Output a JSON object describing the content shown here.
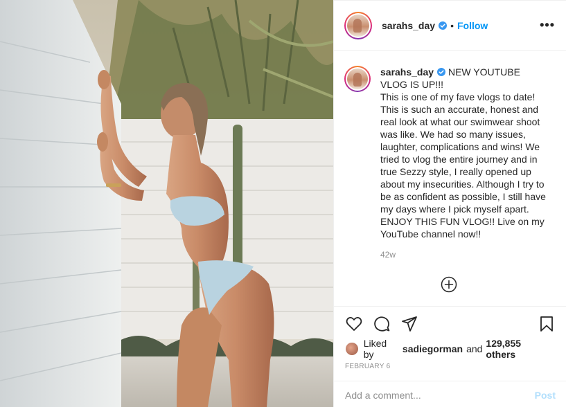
{
  "post": {
    "username": "sarahs_day",
    "verified_icon": "verified-badge-icon",
    "dot": "•",
    "follow_label": "Follow",
    "more_icon": "more-options-icon",
    "more_glyph": "•••",
    "caption_headline": "NEW YOUTUBE VLOG IS UP!!!",
    "caption_body": "This is one of my fave vlogs to date! This is such an accurate, honest and real look at what our swimwear shoot was like. We had so many issues, laughter, complications and wins! We tried to vlog the entire journey and in true Sezzy style, I really opened up about my insecurities. Although I try to be as confident as possible, I still have my days where I pick myself apart. ENJOY THIS FUN VLOG!! Live on my YouTube channel now!!",
    "caption_time": "42w",
    "liked_by_prefix": "Liked by",
    "liked_by_user": "sadiegorman",
    "liked_by_and": "and",
    "liked_by_count": "129,855 others",
    "date": "FEBRUARY 6",
    "comment_placeholder": "Add a comment...",
    "post_label": "Post"
  },
  "icons": {
    "like": "heart-icon",
    "comment": "comment-icon",
    "share": "share-icon",
    "save": "bookmark-icon",
    "load_more": "plus-circle-icon"
  },
  "colors": {
    "link_blue": "#0095f6",
    "post_disabled": "#b2dffc",
    "text": "#262626",
    "muted": "#8e8e8e",
    "divider": "#efefef"
  }
}
